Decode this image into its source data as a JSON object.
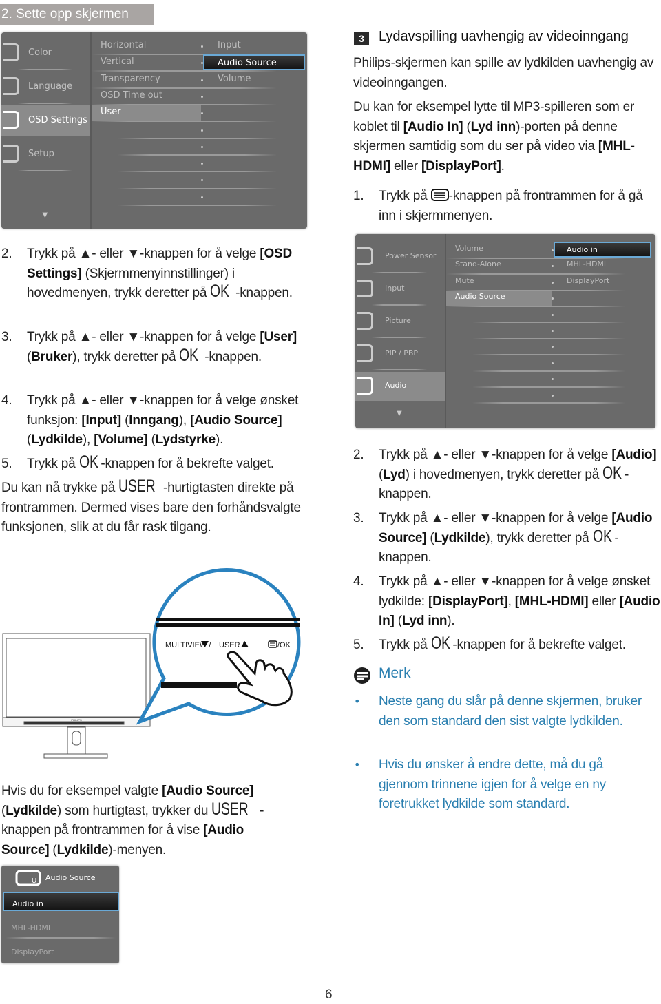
{
  "page": {
    "section_header": "2. Sette opp skjermen",
    "page_number": "6"
  },
  "colors": {
    "accent_blue": "#2a7fb0",
    "osd_bg": "#6a6a6a",
    "osd_select_border": "#6aa9d6",
    "header_bg": "#a9a5a3"
  },
  "osd1": {
    "left": [
      {
        "label": "Color",
        "icon": "color-icon"
      },
      {
        "label": "Language",
        "icon": "language-icon"
      },
      {
        "label": "OSD Settings",
        "icon": "osd-settings-icon",
        "selected": true
      },
      {
        "label": "Setup",
        "icon": "gear-icon"
      }
    ],
    "middle": [
      "Horizontal",
      "Vertical",
      "Transparency",
      "OSD Time out",
      "User"
    ],
    "middle_selected": "User",
    "right": [
      "Input",
      "Audio Source",
      "Volume"
    ],
    "right_selected": "Audio Source"
  },
  "osd2": {
    "left": [
      {
        "label": "Power Sensor",
        "icon": "power-sensor-icon"
      },
      {
        "label": "Input",
        "icon": "input-icon"
      },
      {
        "label": "Picture",
        "icon": "picture-icon"
      },
      {
        "label": "PIP / PBP",
        "icon": "pip-pbp-icon"
      },
      {
        "label": "Audio",
        "icon": "speaker-icon",
        "selected": true
      }
    ],
    "middle": [
      "Volume",
      "Stand-Alone",
      "Mute",
      "Audio Source"
    ],
    "middle_selected": "Audio Source",
    "right": [
      "Audio in",
      "MHL-HDMI",
      "DisplayPort"
    ],
    "right_selected": "Audio in"
  },
  "osd3": {
    "title": "Audio Source",
    "items": [
      "Audio in",
      "MHL-HDMI",
      "DisplayPort"
    ],
    "selected": "Audio in"
  },
  "figure": {
    "multiview": "MULTIVIEW /",
    "user": "USER /",
    "ok": "/OK",
    "brand": "PHILIPS"
  },
  "left": {
    "steps": [
      {
        "num": "2.",
        "segs": [
          {
            "text": "Trykk på ▲- eller ▼-knappen for å velge "
          },
          {
            "text": "[OSD Settings]",
            "bold": true
          },
          {
            "text": " (Skjermmenyinnstillinger) i hovedmenyen, trykk deretter på "
          },
          {
            "text": "OK",
            "key": true
          },
          {
            "text": " -knappen."
          }
        ]
      },
      {
        "num": "3.",
        "segs": [
          {
            "text": "Trykk på ▲- eller ▼-knappen for å velge "
          },
          {
            "text": "[User]",
            "bold": true
          },
          {
            "text": " ("
          },
          {
            "text": "Bruker",
            "bold": true
          },
          {
            "text": "), trykk deretter på "
          },
          {
            "text": "OK",
            "key": true
          },
          {
            "text": " -knappen."
          }
        ]
      },
      {
        "num": "4.",
        "segs": [
          {
            "text": "Trykk på ▲- eller ▼-knappen for å velge ønsket funksjon: "
          },
          {
            "text": "[Input]",
            "bold": true
          },
          {
            "text": " ("
          },
          {
            "text": "Inngang",
            "bold": true
          },
          {
            "text": "), "
          },
          {
            "text": "[Audio Source]",
            "bold": true
          },
          {
            "text": " ("
          },
          {
            "text": "Lydkilde",
            "bold": true
          },
          {
            "text": "), "
          },
          {
            "text": "[Volume]",
            "bold": true
          },
          {
            "text": " ("
          },
          {
            "text": "Lydstyrke",
            "bold": true
          },
          {
            "text": ")."
          }
        ]
      },
      {
        "num": "5.",
        "segs": [
          {
            "text": "Trykk på "
          },
          {
            "text": "OK",
            "key": true
          },
          {
            "text": "-knappen for å bekrefte valget."
          }
        ]
      }
    ],
    "para1": [
      {
        "text": "Du kan nå trykke på "
      },
      {
        "text": "USER",
        "key": true
      },
      {
        "text": "-hurtigtasten direkte på frontrammen. Dermed vises bare den forhåndsvalgte funksjonen, slik at du får rask tilgang."
      }
    ],
    "para2": [
      {
        "text": "Hvis du for eksempel valgte "
      },
      {
        "text": "[Audio Source]",
        "bold": true
      },
      {
        "text": " ("
      },
      {
        "text": "Lydkilde",
        "bold": true
      },
      {
        "text": ") som hurtigtast, trykker du "
      },
      {
        "text": "USER",
        "key": true
      },
      {
        "text": " -knappen på frontrammen for å vise "
      },
      {
        "text": "[Audio Source]",
        "bold": true
      },
      {
        "text": " ("
      },
      {
        "text": "Lydkilde",
        "bold": true
      },
      {
        "text": ")-menyen."
      }
    ]
  },
  "right": {
    "heading_number": "3",
    "heading": "Lydavspilling uavhengig av videoinngang",
    "para1": [
      {
        "text": "Philips-skjermen kan spille av lydkilden uavhengig av videoinngangen."
      }
    ],
    "para2": [
      {
        "text": "Du kan for eksempel lytte til MP3-spilleren som er koblet til "
      },
      {
        "text": "[Audio In]",
        "bold": true
      },
      {
        "text": " ("
      },
      {
        "text": "Lyd inn",
        "bold": true
      },
      {
        "text": ")-porten på denne skjermen samtidig som du ser på video via "
      },
      {
        "text": "[MHL-HDMI]",
        "bold": true
      },
      {
        "text": " eller "
      },
      {
        "text": "[DisplayPort]",
        "bold": true
      },
      {
        "text": "."
      }
    ],
    "step1": {
      "num": "1.",
      "segs": [
        {
          "text": "Trykk på "
        },
        {
          "icon": "menu-button-icon"
        },
        {
          "text": "-knappen på frontrammen for å gå inn i skjermmenyen."
        }
      ]
    },
    "steps": [
      {
        "num": "2.",
        "segs": [
          {
            "text": "Trykk på ▲- eller ▼-knappen for å velge "
          },
          {
            "text": "[Audio]",
            "bold": true
          },
          {
            "text": " ("
          },
          {
            "text": "Lyd",
            "bold": true
          },
          {
            "text": ") i hovedmenyen, trykk deretter på "
          },
          {
            "text": "OK",
            "key": true
          },
          {
            "text": "-knappen."
          }
        ]
      },
      {
        "num": "3.",
        "segs": [
          {
            "text": "Trykk på ▲- eller ▼-knappen for å velge "
          },
          {
            "text": "[Audio Source]",
            "bold": true
          },
          {
            "text": " ("
          },
          {
            "text": "Lydkilde",
            "bold": true
          },
          {
            "text": "), trykk deretter på "
          },
          {
            "text": "OK",
            "key": true
          },
          {
            "text": "-knappen."
          }
        ]
      },
      {
        "num": "4.",
        "segs": [
          {
            "text": "Trykk på ▲- eller ▼-knappen for å velge ønsket lydkilde: "
          },
          {
            "text": "[DisplayPort]",
            "bold": true
          },
          {
            "text": ", "
          },
          {
            "text": "[MHL-HDMI]",
            "bold": true
          },
          {
            "text": " eller "
          },
          {
            "text": "[Audio In]",
            "bold": true
          },
          {
            "text": " ("
          },
          {
            "text": "Lyd inn",
            "bold": true
          },
          {
            "text": ")."
          }
        ]
      },
      {
        "num": "5.",
        "segs": [
          {
            "text": "Trykk på "
          },
          {
            "text": "OK",
            "key": true
          },
          {
            "text": "-knappen for å bekrefte valget."
          }
        ]
      }
    ],
    "note": {
      "title": "Merk",
      "bullets": [
        "Neste gang du slår på denne skjermen, bruker den som standard den sist valgte lydkilden.",
        "Hvis du ønsker å endre dette, må du gå gjennom trinnene igjen for å velge en ny foretrukket lydkilde som standard."
      ]
    }
  }
}
